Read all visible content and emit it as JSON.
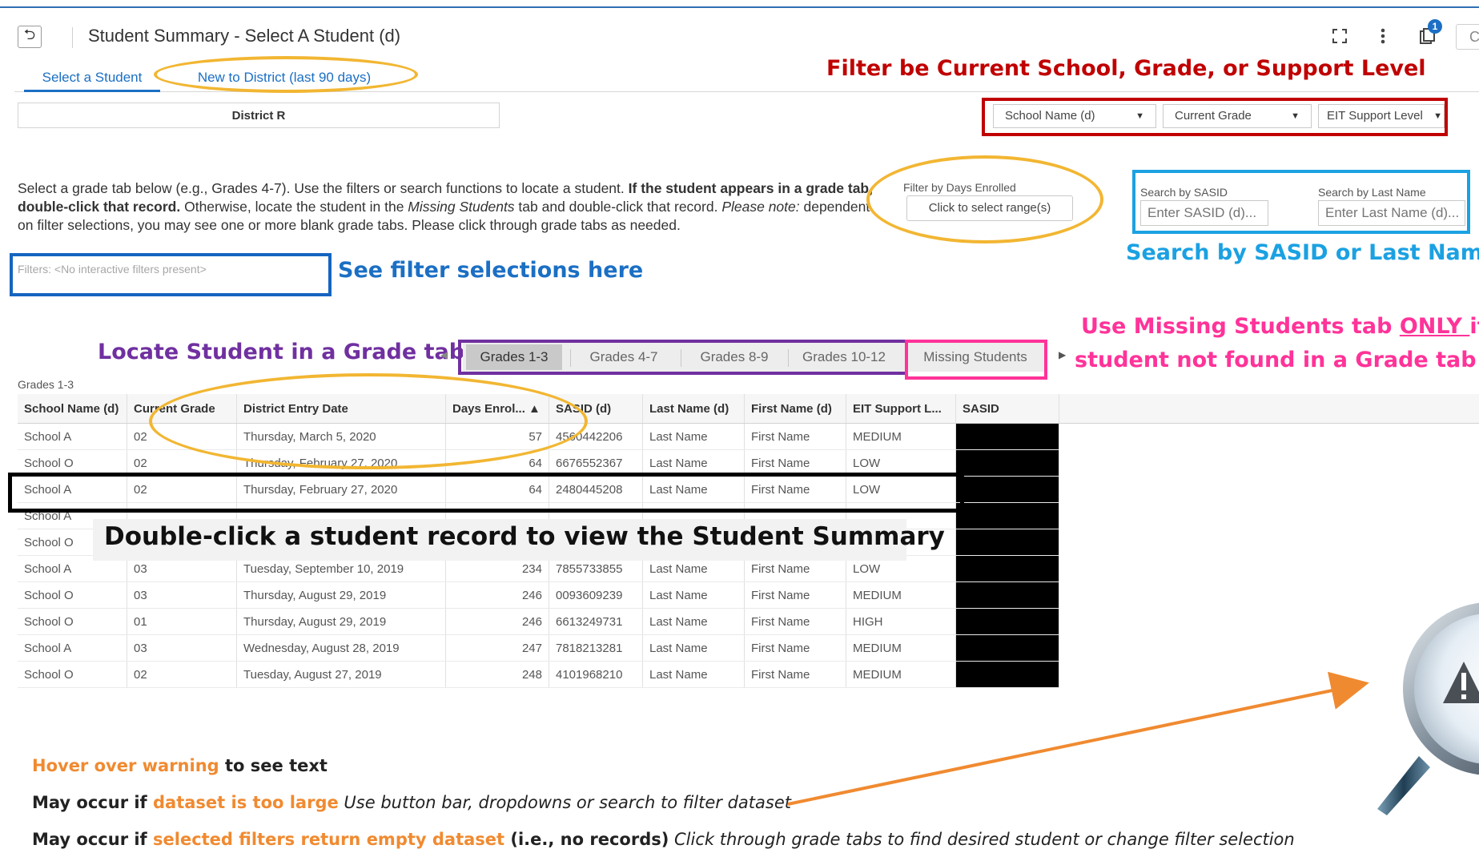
{
  "app": {
    "title": "Student Summary - Select A Student (d)",
    "cut_button_text": "C",
    "notification_count": "1"
  },
  "tabs": [
    {
      "label": "Select a Student",
      "active": true
    },
    {
      "label": "New to District (last 90 days)",
      "active": false
    }
  ],
  "district": "District R",
  "dropdowns": [
    {
      "label": "School Name (d)"
    },
    {
      "label": "Current Grade"
    },
    {
      "label": "EIT Support Level"
    }
  ],
  "instructions": {
    "p1": "Select a grade tab below (e.g., Grades 4-7). Use the filters or search functions to locate a student. ",
    "p1_bold": "If the student appears in a grade tab, double-click that record.",
    "p2": " Otherwise, locate the student in the ",
    "p2_italic": "Missing Students",
    "p3": " tab and double-click that record. ",
    "p3_italic": "Please note:",
    "p4": " dependent on filter selections, you may see one or more blank grade tabs. Please click through grade tabs as needed."
  },
  "filters_line": "Filters: <No interactive filters present>",
  "days_filter": {
    "label": "Filter by Days Enrolled",
    "button": "Click to select range(s)"
  },
  "search": {
    "sasid_label": "Search by SASID",
    "sasid_placeholder": "Enter SASID (d)...",
    "lastname_label": "Search by Last Name",
    "lastname_placeholder": "Enter Last Name (d)..."
  },
  "annotations": {
    "filter_note": "Filter be Current School, Grade, or Support Level",
    "search_note": "Search by SASID or Last Name",
    "filter_sel_note": "See filter selections here",
    "locate_note": "Locate Student in a Grade tab",
    "missing_note_1a": "Use Missing Students tab ",
    "missing_note_1b": "ONLY ",
    "missing_note_1c": "if",
    "missing_note_2": "student not found in a Grade tab",
    "dblclick_note": "Double-click a student record to view the Student Summary"
  },
  "grade_tabs": [
    "Grades 1-3",
    "Grades 4-7",
    "Grades 8-9",
    "Grades 10-12",
    "Missing Students"
  ],
  "grade_label": "Grades 1-3",
  "table": {
    "columns": [
      "School Name (d)",
      "Current Grade",
      "District Entry Date",
      "Days Enrol... ▲",
      "SASID (d)",
      "Last Name (d)",
      "First Name (d)",
      "EIT Support L...",
      "SASID"
    ],
    "rows": [
      [
        "School A",
        "02",
        "Thursday, March 5, 2020",
        "57",
        "4560442206",
        "Last Name",
        "First Name",
        "MEDIUM",
        ""
      ],
      [
        "School O",
        "02",
        "Thursday, February 27, 2020",
        "64",
        "6676552367",
        "Last Name",
        "First Name",
        "LOW",
        ""
      ],
      [
        "School A",
        "02",
        "Thursday, February 27, 2020",
        "64",
        "2480445208",
        "Last Name",
        "First Name",
        "LOW",
        ""
      ],
      [
        "School A",
        "",
        "",
        "",
        "",
        "",
        "",
        "",
        ""
      ],
      [
        "School O",
        "",
        "",
        "",
        "",
        "",
        "",
        "",
        ""
      ],
      [
        "School A",
        "03",
        "Tuesday, September 10, 2019",
        "234",
        "7855733855",
        "Last Name",
        "First Name",
        "LOW",
        ""
      ],
      [
        "School O",
        "03",
        "Thursday, August 29, 2019",
        "246",
        "0093609239",
        "Last Name",
        "First Name",
        "MEDIUM",
        ""
      ],
      [
        "School O",
        "01",
        "Thursday, August 29, 2019",
        "246",
        "6613249731",
        "Last Name",
        "First Name",
        "HIGH",
        ""
      ],
      [
        "School A",
        "03",
        "Wednesday, August 28, 2019",
        "247",
        "7818213281",
        "Last Name",
        "First Name",
        "MEDIUM",
        ""
      ],
      [
        "School O",
        "02",
        "Tuesday, August 27, 2019",
        "248",
        "4101968210",
        "Last Name",
        "First Name",
        "MEDIUM",
        ""
      ]
    ]
  },
  "notes": {
    "n1_o": "Hover over warning",
    "n1": " to see text",
    "n2": "May occur if ",
    "n2_o": "dataset is too large",
    "n2_i": " Use button bar, dropdowns or search to filter dataset",
    "n3": "May occur if ",
    "n3_o": "selected filters return empty dataset",
    "n3_b": " (i.e., no records)",
    "n3_i": " Click through grade tabs to find desired student or change filter selection"
  },
  "colors": {
    "accent_blue": "#1b6fc4",
    "annot_red": "#c00000",
    "annot_cyan": "#1ba1e2",
    "annot_purple": "#7030a0",
    "annot_pink": "#ff3399",
    "ellipse_yellow": "#f2b632",
    "note_orange": "#f08a30"
  },
  "icons": [
    "back-icon",
    "fullscreen-icon",
    "more-vert-icon",
    "notification-icon",
    "warning-icon",
    "magnifier-icon"
  ]
}
